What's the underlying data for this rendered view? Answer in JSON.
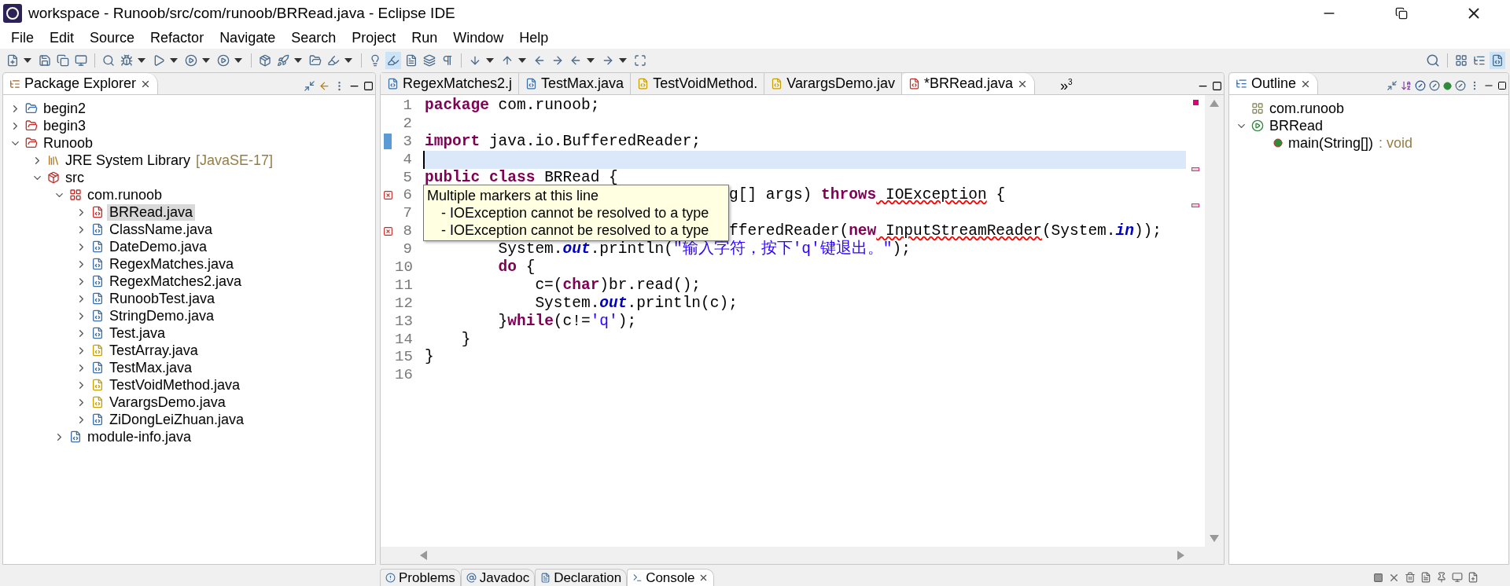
{
  "window": {
    "title": "workspace - Runoob/src/com/runoob/BRRead.java - Eclipse IDE"
  },
  "menu": [
    "File",
    "Edit",
    "Source",
    "Refactor",
    "Navigate",
    "Search",
    "Project",
    "Run",
    "Window",
    "Help"
  ],
  "package_explorer": {
    "title": "Package Explorer",
    "items": [
      {
        "label": "begin2",
        "kind": "project",
        "expanded": false,
        "selected": false
      },
      {
        "label": "begin3",
        "kind": "project-error",
        "expanded": false,
        "selected": false
      },
      {
        "label": "Runoob",
        "kind": "project-error",
        "expanded": true,
        "selected": false,
        "children": [
          {
            "label": "JRE System Library",
            "decoration": "[JavaSE-17]",
            "kind": "library",
            "expanded": false,
            "selected": false
          },
          {
            "label": "src",
            "kind": "source-error",
            "expanded": true,
            "selected": false,
            "children": [
              {
                "label": "com.runoob",
                "kind": "package-error",
                "expanded": true,
                "selected": false,
                "children": [
                  {
                    "label": "BRRead.java",
                    "kind": "java-error",
                    "expanded": false,
                    "selected": true
                  },
                  {
                    "label": "ClassName.java",
                    "kind": "java",
                    "expanded": false,
                    "selected": false
                  },
                  {
                    "label": "DateDemo.java",
                    "kind": "java",
                    "expanded": false,
                    "selected": false
                  },
                  {
                    "label": "RegexMatches.java",
                    "kind": "java",
                    "expanded": false,
                    "selected": false
                  },
                  {
                    "label": "RegexMatches2.java",
                    "kind": "java",
                    "expanded": false,
                    "selected": false
                  },
                  {
                    "label": "RunoobTest.java",
                    "kind": "java",
                    "expanded": false,
                    "selected": false
                  },
                  {
                    "label": "StringDemo.java",
                    "kind": "java",
                    "expanded": false,
                    "selected": false
                  },
                  {
                    "label": "Test.java",
                    "kind": "java",
                    "expanded": false,
                    "selected": false
                  },
                  {
                    "label": "TestArray.java",
                    "kind": "java-warning",
                    "expanded": false,
                    "selected": false
                  },
                  {
                    "label": "TestMax.java",
                    "kind": "java",
                    "expanded": false,
                    "selected": false
                  },
                  {
                    "label": "TestVoidMethod.java",
                    "kind": "java-warning",
                    "expanded": false,
                    "selected": false
                  },
                  {
                    "label": "VarargsDemo.java",
                    "kind": "java-warning",
                    "expanded": false,
                    "selected": false
                  },
                  {
                    "label": "ZiDongLeiZhuan.java",
                    "kind": "java",
                    "expanded": false,
                    "selected": false
                  }
                ]
              },
              {
                "label": "module-info.java",
                "kind": "java",
                "expanded": false,
                "selected": false
              }
            ]
          }
        ]
      }
    ]
  },
  "editor": {
    "tabs": [
      {
        "label": "RegexMatches2.j",
        "kind": "java",
        "selected": false
      },
      {
        "label": "TestMax.java",
        "kind": "java",
        "selected": false
      },
      {
        "label": "TestVoidMethod.",
        "kind": "java-warning",
        "selected": false
      },
      {
        "label": "VarargsDemo.jav",
        "kind": "java-warning",
        "selected": false
      },
      {
        "label": "*BRRead.java",
        "kind": "java-error",
        "selected": true
      }
    ],
    "overflow": "»",
    "overflow_count": "3",
    "lines": [
      {
        "number": "1",
        "current": false,
        "covered": false,
        "changed": false,
        "error": false,
        "tokens": [
          {
            "text": "package",
            "kind": "keyword"
          },
          {
            "text": " com.runoob;",
            "kind": "plain"
          }
        ]
      },
      {
        "number": "2",
        "current": false,
        "covered": false,
        "changed": false,
        "error": false
      },
      {
        "number": "3",
        "current": false,
        "covered": false,
        "changed": true,
        "error": false,
        "tokens": [
          {
            "text": "import",
            "kind": "keyword"
          },
          {
            "text": " java.io.BufferedReader;",
            "kind": "plain"
          }
        ]
      },
      {
        "number": "4",
        "current": true,
        "covered": false,
        "changed": false,
        "error": false
      },
      {
        "number": "5",
        "current": false,
        "covered": false,
        "changed": false,
        "error": false,
        "tokens": [
          {
            "text": "public",
            "kind": "keyword"
          },
          {
            "text": " class",
            "kind": "keyword"
          },
          {
            "text": " BRRead {",
            "kind": "plain"
          }
        ]
      },
      {
        "number": "6",
        "current": false,
        "covered": true,
        "changed": false,
        "error": true,
        "tokens": [
          {
            "text": "g[] args) ",
            "kind": "plain"
          },
          {
            "text": "throws",
            "kind": "keyword"
          },
          {
            "text": " IOException",
            "kind": "error"
          },
          {
            "text": " {",
            "kind": "plain"
          }
        ]
      },
      {
        "number": "7",
        "current": false,
        "covered": true,
        "changed": false,
        "error": false
      },
      {
        "number": "8",
        "current": false,
        "covered": true,
        "changed": false,
        "error": true,
        "tokens": [
          {
            "text": "fferedReader(",
            "kind": "plain"
          },
          {
            "text": "new",
            "kind": "keyword"
          },
          {
            "text": " InputStreamReader",
            "kind": "error"
          },
          {
            "text": "(System.",
            "kind": "plain"
          },
          {
            "text": "in",
            "kind": "field"
          },
          {
            "text": "));",
            "kind": "plain"
          }
        ]
      },
      {
        "number": "9",
        "current": false,
        "covered": false,
        "changed": false,
        "error": false,
        "tokens": [
          {
            "text": "        System.",
            "kind": "plain"
          },
          {
            "text": "out",
            "kind": "field"
          },
          {
            "text": ".println(",
            "kind": "plain"
          },
          {
            "text": "\"输入字符，按下'q'键退出。\"",
            "kind": "string"
          },
          {
            "text": ");",
            "kind": "plain"
          }
        ]
      },
      {
        "number": "10",
        "current": false,
        "covered": false,
        "changed": false,
        "error": false,
        "tokens": [
          {
            "text": "        do",
            "kind": "keyword"
          },
          {
            "text": " {",
            "kind": "plain"
          }
        ]
      },
      {
        "number": "11",
        "current": false,
        "covered": false,
        "changed": false,
        "error": false,
        "tokens": [
          {
            "text": "            c=(",
            "kind": "plain"
          },
          {
            "text": "char",
            "kind": "keyword"
          },
          {
            "text": ")br.read();",
            "kind": "plain"
          }
        ]
      },
      {
        "number": "12",
        "current": false,
        "covered": false,
        "changed": false,
        "error": false,
        "tokens": [
          {
            "text": "            System.",
            "kind": "plain"
          },
          {
            "text": "out",
            "kind": "field"
          },
          {
            "text": ".println(c);",
            "kind": "plain"
          }
        ]
      },
      {
        "number": "13",
        "current": false,
        "covered": false,
        "changed": false,
        "error": false,
        "tokens": [
          {
            "text": "        }",
            "kind": "plain"
          },
          {
            "text": "while",
            "kind": "keyword"
          },
          {
            "text": "(c!=",
            "kind": "plain"
          },
          {
            "text": "'q'",
            "kind": "string"
          },
          {
            "text": ");",
            "kind": "plain"
          }
        ]
      },
      {
        "number": "14",
        "current": false,
        "covered": false,
        "changed": false,
        "error": false,
        "tokens": [
          {
            "text": "    }",
            "kind": "plain"
          }
        ]
      },
      {
        "number": "15",
        "current": false,
        "covered": false,
        "changed": false,
        "error": false,
        "tokens": [
          {
            "text": "}",
            "kind": "plain"
          }
        ]
      },
      {
        "number": "16",
        "current": false,
        "covered": false,
        "changed": false,
        "error": false
      }
    ],
    "tooltip": {
      "title": "Multiple markers at this line",
      "items": [
        "- IOException cannot be resolved to a type",
        "- IOException cannot be resolved to a type"
      ]
    }
  },
  "outline": {
    "title": "Outline",
    "items": [
      {
        "label": "com.runoob",
        "kind": "package"
      },
      {
        "label": "BRRead",
        "kind": "class-error",
        "expanded": true,
        "children": [
          {
            "label": "main(String[])",
            "decoration": " : void",
            "kind": "method-error"
          }
        ]
      }
    ]
  },
  "bottom_tabs": [
    {
      "label": "Problems",
      "selected": false
    },
    {
      "label": "Javadoc",
      "selected": false
    },
    {
      "label": "Declaration",
      "selected": false
    },
    {
      "label": "Console",
      "selected": true
    }
  ]
}
